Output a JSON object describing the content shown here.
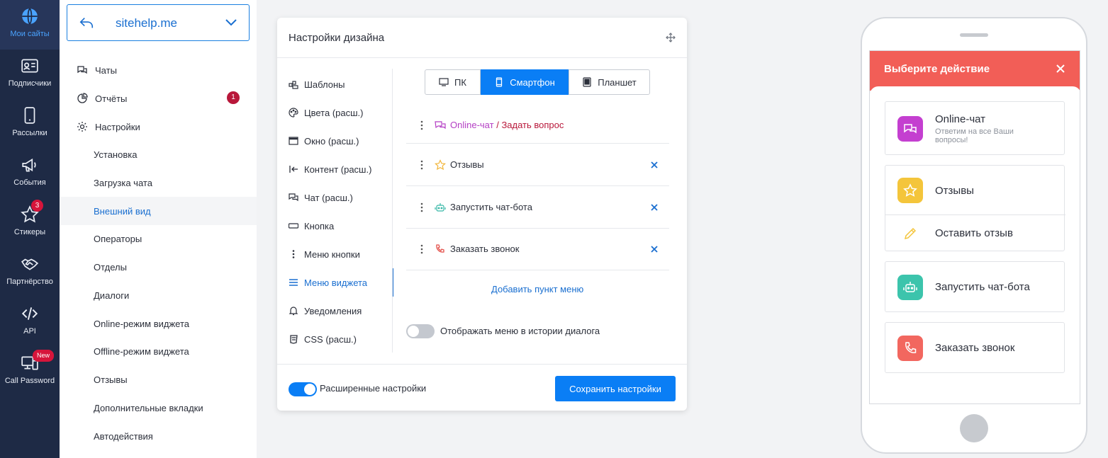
{
  "rail": [
    {
      "label": "Мои сайты",
      "icon": "globe-icon",
      "active": true
    },
    {
      "label": "Подписчики",
      "icon": "contact-card-icon"
    },
    {
      "label": "Рассылки",
      "icon": "phone-icon"
    },
    {
      "label": "События",
      "icon": "megaphone-icon"
    },
    {
      "label": "Стикеры",
      "icon": "star-icon",
      "badge": "3"
    },
    {
      "label": "Партнёрство",
      "icon": "handshake-icon"
    },
    {
      "label": "API",
      "icon": "code-icon"
    },
    {
      "label": "Call Password",
      "icon": "computer-phone-icon",
      "badge": "New"
    }
  ],
  "sidebar": {
    "site": "sitehelp.me",
    "top_items": [
      {
        "label": "Чаты",
        "icon": "chat-icon"
      },
      {
        "label": "Отчёты",
        "icon": "pie-chart-icon",
        "badge": "1"
      },
      {
        "label": "Настройки",
        "icon": "gear-icon"
      }
    ],
    "sub_items": [
      {
        "label": "Установка"
      },
      {
        "label": "Загрузка чата"
      },
      {
        "label": "Внешний вид",
        "active": true
      },
      {
        "label": "Операторы"
      },
      {
        "label": "Отделы"
      },
      {
        "label": "Диалоги"
      },
      {
        "label": "Online-режим виджета"
      },
      {
        "label": "Offline-режим виджета"
      },
      {
        "label": "Отзывы"
      },
      {
        "label": "Дополнительные вкладки"
      },
      {
        "label": "Автодействия"
      }
    ]
  },
  "card": {
    "title": "Настройки дизайна",
    "menu": [
      {
        "label": "Шаблоны",
        "icon": "template-icon"
      },
      {
        "label": "Цвета (расш.)",
        "icon": "palette-icon"
      },
      {
        "label": "Окно (расш.)",
        "icon": "window-icon"
      },
      {
        "label": "Контент (расш.)",
        "icon": "arrow-left-bar-icon"
      },
      {
        "label": "Чат (расш.)",
        "icon": "chat-icon"
      },
      {
        "label": "Кнопка",
        "icon": "button-icon"
      },
      {
        "label": "Меню кнопки",
        "icon": "vertical-dots-icon"
      },
      {
        "label": "Меню виджета",
        "icon": "hamburger-icon",
        "active": true
      },
      {
        "label": "Уведомления",
        "icon": "bell-icon"
      },
      {
        "label": "CSS (расш.)",
        "icon": "css-icon"
      }
    ],
    "devices": [
      {
        "label": "ПК",
        "icon": "monitor-icon"
      },
      {
        "label": "Смартфон",
        "icon": "smartphone-icon",
        "active": true
      },
      {
        "label": "Планшет",
        "icon": "tablet-icon"
      }
    ],
    "rows": [
      {
        "label_a": "Online-чат",
        "label_sep": " / ",
        "label_b": "Задать вопрос",
        "icon": "chat-bubbles-icon",
        "color_a": "#b43fc4",
        "color_b": "#b8173a",
        "removable": false
      },
      {
        "label_a": "Отзывы",
        "icon": "star-outline-icon",
        "color": "#f2b63b",
        "removable": true
      },
      {
        "label_a": "Запустить чат-бота",
        "icon": "robot-icon",
        "color": "#36b7a6",
        "removable": true
      },
      {
        "label_a": "Заказать звонок",
        "icon": "phone-handset-icon",
        "color": "#e4514b",
        "removable": true
      }
    ],
    "add_label": "Добавить пункт меню",
    "history_toggle_label": "Отображать меню в истории диалога",
    "history_toggle_on": false,
    "advanced_toggle_label": "Расширенные настройки",
    "advanced_toggle_on": true,
    "save_label": "Сохранить настройки"
  },
  "preview": {
    "title": "Выберите действие",
    "options": [
      {
        "label": "Online-чат",
        "sub": "Ответим на все Ваши вопросы!",
        "icon": "chat-bubbles-icon",
        "color": "#c43fd0"
      },
      {
        "label": "Отзывы",
        "icon": "star-outline-icon",
        "color": "#f4c53b"
      },
      {
        "label": "Оставить отзыв",
        "icon": "pencil-icon",
        "color": "#f4c53b"
      },
      {
        "label": "Запустить чат-бота",
        "icon": "robot-icon",
        "color": "#3cc4ac"
      },
      {
        "label": "Заказать звонок",
        "icon": "phone-handset-icon",
        "color": "#f2675f"
      }
    ]
  }
}
